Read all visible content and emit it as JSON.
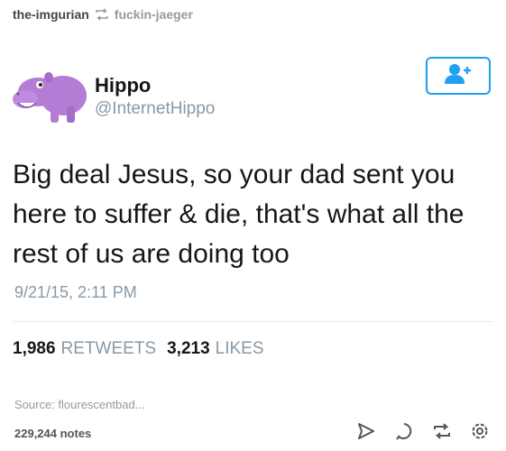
{
  "reblog": {
    "from_user": "the-imgurian",
    "to_user": "fuckin-jaeger",
    "icon": "reblog-icon"
  },
  "tweet": {
    "display_name": "Hippo",
    "handle": "@InternetHippo",
    "text": "Big deal Jesus, so your dad sent you here to suffer & die, that's what all the rest of us are doing too",
    "timestamp": "9/21/15, 2:11 PM",
    "retweets_count": "1,986",
    "retweets_label": "RETWEETS",
    "likes_count": "3,213",
    "likes_label": "LIKES",
    "follow_icon": "follow-user-icon",
    "colors": {
      "twitter_blue": "#1da1f2",
      "avatar_purple": "#b57cd6"
    }
  },
  "post_footer": {
    "source": "Source: flourescentbad...",
    "notes": "229,244 notes",
    "actions": [
      "share-icon",
      "reply-icon",
      "reblog-icon",
      "settings-icon"
    ]
  }
}
